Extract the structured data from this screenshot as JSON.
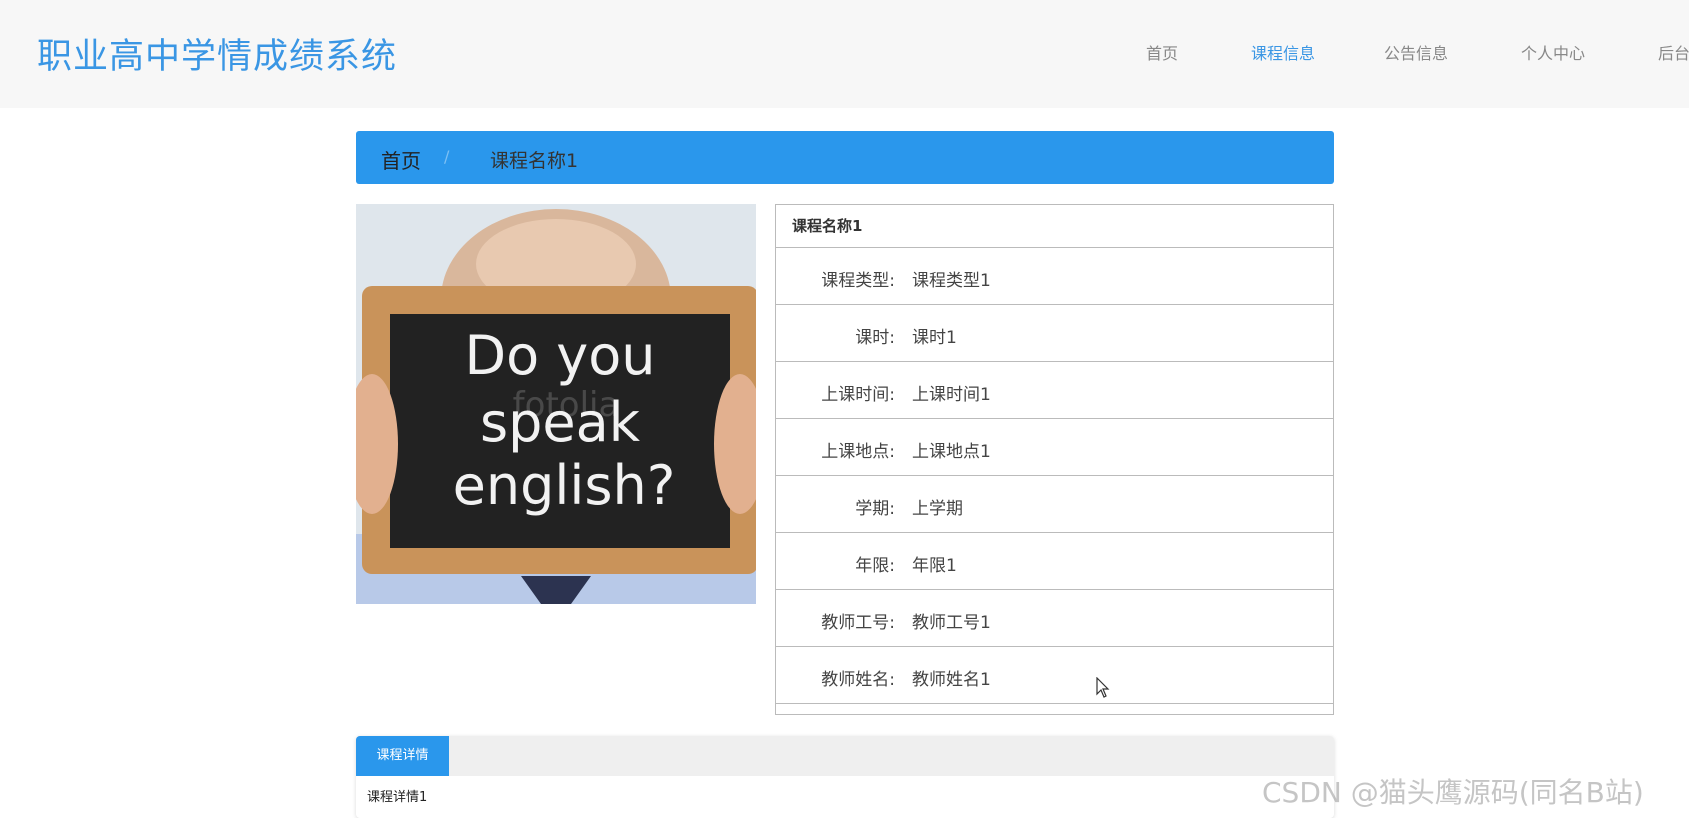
{
  "site": {
    "title": "职业高中学情成绩系统"
  },
  "nav": {
    "items": [
      {
        "label": "首页"
      },
      {
        "label": "课程信息",
        "active": true
      },
      {
        "label": "公告信息"
      },
      {
        "label": "个人中心"
      },
      {
        "label": "后台"
      }
    ]
  },
  "breadcrumb": {
    "home": "首页",
    "separator": "/",
    "current": "课程名称1"
  },
  "image": {
    "chalkboard_text": [
      "Do you",
      "speak",
      "english?"
    ],
    "watermark": "fotolia"
  },
  "course": {
    "name": "课程名称1",
    "fields": [
      {
        "label": "课程类型:",
        "value": "课程类型1"
      },
      {
        "label": "课时:",
        "value": "课时1"
      },
      {
        "label": "上课时间:",
        "value": "上课时间1"
      },
      {
        "label": "上课地点:",
        "value": "上课地点1"
      },
      {
        "label": "学期:",
        "value": "上学期"
      },
      {
        "label": "年限:",
        "value": "年限1"
      },
      {
        "label": "教师工号:",
        "value": "教师工号1"
      },
      {
        "label": "教师姓名:",
        "value": "教师姓名1"
      }
    ]
  },
  "tabs": {
    "active_label": "课程详情",
    "content": "课程详情1"
  },
  "watermark": "CSDN @猫头鹰源码(同名B站)",
  "colors": {
    "accent": "#2a97ec",
    "title": "#3a96e4"
  }
}
